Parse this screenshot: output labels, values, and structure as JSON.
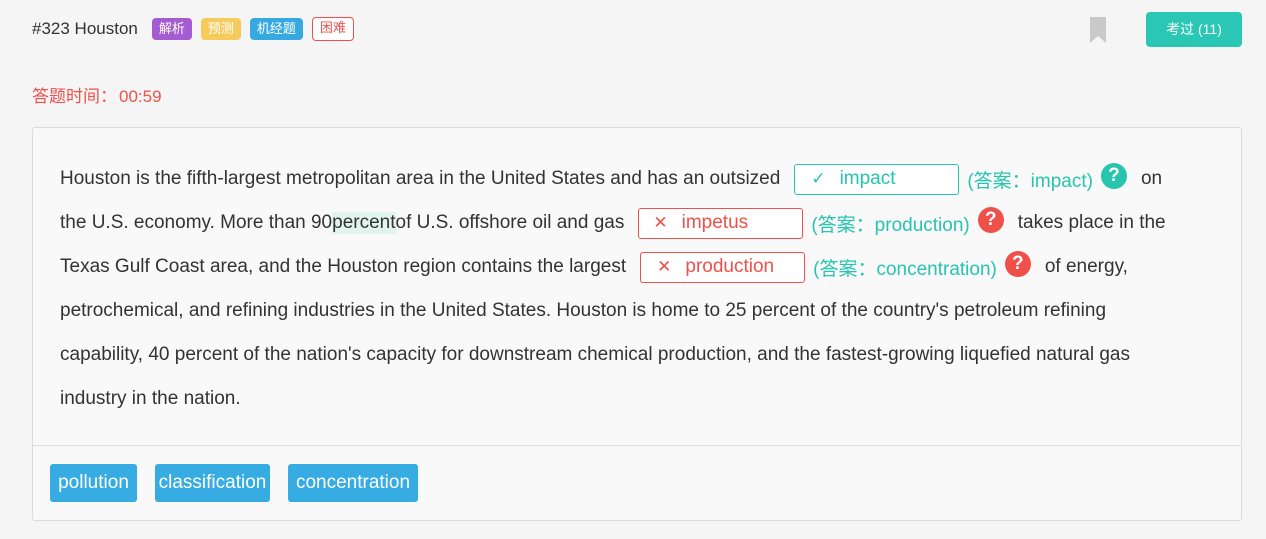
{
  "header": {
    "question_title": "#323 Houston",
    "tags": [
      "解析",
      "预测",
      "机经题",
      "困难"
    ],
    "passed_button": "考过 (11)",
    "colors": {
      "teal": "#2ac8b4",
      "purple": "#a55bd1",
      "yellow": "#f5cc5c",
      "blue": "#37a9e1",
      "red": "#f0504a"
    }
  },
  "timer": {
    "label": "答题时间：",
    "value": "00:59"
  },
  "passage": {
    "l1_text": "Houston is the fifth-largest metropolitan area in the United States and has an outsized",
    "blank1": {
      "mark": "✓",
      "value": "impact",
      "answer": "(答案：impact)",
      "status": "correct"
    },
    "l1_after": "on",
    "l2_pre": "the U.S. economy. More than 90 ",
    "l2_highlight": "percent",
    "l2_post": " of U.S. offshore oil and gas",
    "blank2": {
      "mark": "✕",
      "value": "impetus",
      "answer": "(答案：production)",
      "status": "wrong"
    },
    "l2_after": "takes place in the",
    "l3_text": "Texas Gulf Coast area, and the Houston region contains the largest",
    "blank3": {
      "mark": "✕",
      "value": "production",
      "answer": "(答案：concentration)",
      "status": "wrong"
    },
    "l3_after": "of energy,",
    "l4": "petrochemical, and refining industries in the United States. Houston is home to 25 percent of the country's petroleum refining",
    "l5": "capability, 40 percent of the nation's capacity for downstream chemical production, and the fastest-growing liquefied natural gas",
    "l6": "industry in the nation.",
    "help_icon": "?"
  },
  "options": [
    "pollution",
    "classification",
    "concentration"
  ]
}
